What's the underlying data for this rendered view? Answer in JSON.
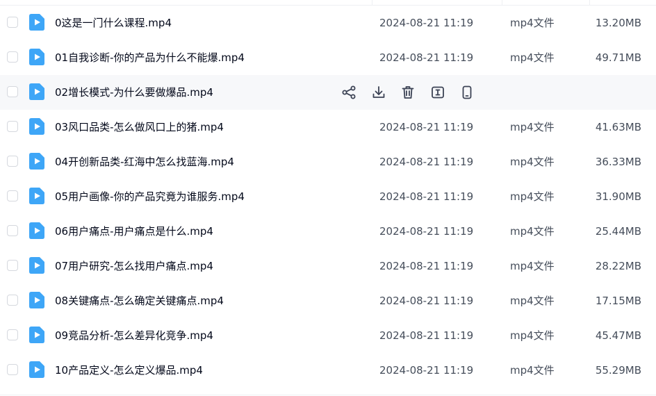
{
  "files": [
    {
      "name": "0这是一门什么课程.mp4",
      "date": "2024-08-21 11:19",
      "type": "mp4文件",
      "size": "13.20MB"
    },
    {
      "name": "01自我诊断-你的产品为什么不能爆.mp4",
      "date": "2024-08-21 11:19",
      "type": "mp4文件",
      "size": "49.71MB"
    },
    {
      "name": "02增长模式-为什么要做爆品.mp4",
      "date": "",
      "type": "",
      "size": ""
    },
    {
      "name": "03风口品类-怎么做风口上的猪.mp4",
      "date": "2024-08-21 11:19",
      "type": "mp4文件",
      "size": "41.63MB"
    },
    {
      "name": "04开创新品类-红海中怎么找蓝海.mp4",
      "date": "2024-08-21 11:19",
      "type": "mp4文件",
      "size": "36.33MB"
    },
    {
      "name": "05用户画像-你的产品究竟为谁服务.mp4",
      "date": "2024-08-21 11:19",
      "type": "mp4文件",
      "size": "31.90MB"
    },
    {
      "name": "06用户痛点-用户痛点是什么.mp4",
      "date": "2024-08-21 11:19",
      "type": "mp4文件",
      "size": "25.44MB"
    },
    {
      "name": "07用户研究-怎么找用户痛点.mp4",
      "date": "2024-08-21 11:19",
      "type": "mp4文件",
      "size": "28.22MB"
    },
    {
      "name": "08关键痛点-怎么确定关键痛点.mp4",
      "date": "2024-08-21 11:19",
      "type": "mp4文件",
      "size": "17.15MB"
    },
    {
      "name": "09竞品分析-怎么差异化竞争.mp4",
      "date": "2024-08-21 11:19",
      "type": "mp4文件",
      "size": "45.47MB"
    },
    {
      "name": "10产品定义-怎么定义爆品.mp4",
      "date": "2024-08-21 11:19",
      "type": "mp4文件",
      "size": "55.29MB"
    }
  ],
  "hovered_row": 2,
  "row_actions": [
    "share-icon",
    "download-icon",
    "delete-icon",
    "rename-icon",
    "phone-icon"
  ],
  "colors": {
    "file_icon": "#3ea6f7",
    "hover_bg": "#f7f8fa",
    "text_primary": "#03081a",
    "text_secondary": "#454d5a",
    "action_icon": "#3b4254"
  }
}
